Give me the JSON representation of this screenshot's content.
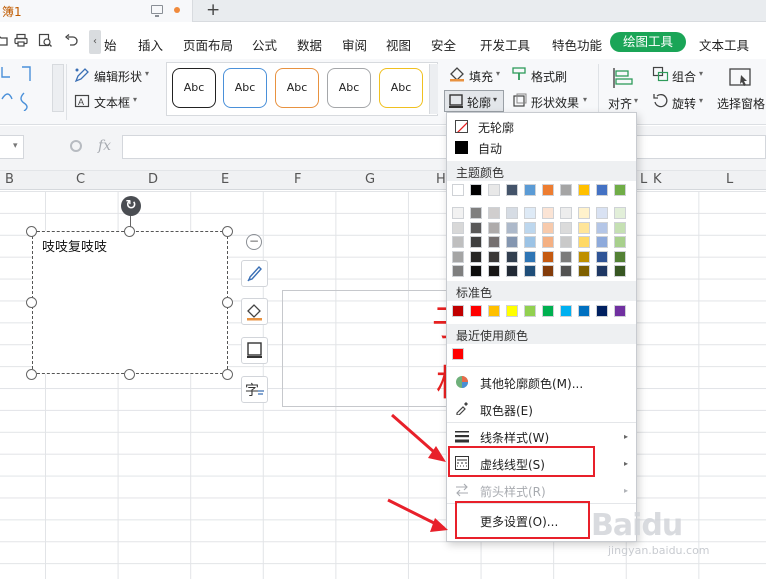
{
  "tabs": {
    "document_title": "簿1",
    "new_tab": "+"
  },
  "menu": {
    "items": [
      "始",
      "插入",
      "页面布局",
      "公式",
      "数据",
      "审阅",
      "视图",
      "安全",
      "开发工具",
      "特色功能",
      "绘图工具",
      "文本工具"
    ],
    "active": "绘图工具",
    "accent_color": "#1aa557"
  },
  "ribbon": {
    "edit_shape": "编辑形状",
    "text_box": "文本框",
    "style_samples": [
      "Abc",
      "Abc",
      "Abc",
      "Abc",
      "Abc"
    ],
    "style_borders": [
      "#222222",
      "#4a90d9",
      "#e89240",
      "#a5a7aa",
      "#f0c020"
    ],
    "fill": "填充",
    "format_painter": "格式刷",
    "outline": "轮廓",
    "shape_effects": "形状效果",
    "align": "对齐",
    "group": "组合",
    "rotate": "旋转",
    "selection_pane": "选择窗格"
  },
  "formula_bar": {
    "fx": "fx"
  },
  "columns": [
    "B",
    "C",
    "D",
    "E",
    "F",
    "G",
    "H",
    "L",
    "K",
    "L"
  ],
  "sheet": {
    "textbox_text": "吱吱复吱吱",
    "red_char_1": "子",
    "red_char_2": "相"
  },
  "outline_menu": {
    "no_outline": "无轮廓",
    "auto": "自动",
    "theme_colors_label": "主题颜色",
    "theme_top_row": [
      "#ffffff",
      "#000000",
      "#e8e8e8",
      "#44546a",
      "#5b9bd5",
      "#ed7d31",
      "#a5a5a5",
      "#ffc000",
      "#4472c4",
      "#70ad47"
    ],
    "theme_shades": [
      [
        "#f2f2f2",
        "#7f7f7f",
        "#d0cece",
        "#d6dce4",
        "#deeaf6",
        "#fbe4d5",
        "#ededed",
        "#fff2cc",
        "#d9e2f3",
        "#e2efd9"
      ],
      [
        "#d8d8d8",
        "#595959",
        "#aeabab",
        "#adb9ca",
        "#bdd7ee",
        "#f7caac",
        "#dbdbdb",
        "#ffe599",
        "#b4c6e7",
        "#c5e0b3"
      ],
      [
        "#bfbfbf",
        "#3f3f3f",
        "#757070",
        "#8496b0",
        "#9cc3e5",
        "#f4b083",
        "#c9c9c9",
        "#ffd965",
        "#8eaadb",
        "#a8d08d"
      ],
      [
        "#a5a5a5",
        "#262626",
        "#3a3838",
        "#323f4f",
        "#2e75b5",
        "#c55a11",
        "#7b7b7b",
        "#bf9000",
        "#2f5496",
        "#538135"
      ],
      [
        "#7f7f7f",
        "#0c0c0c",
        "#171616",
        "#222a35",
        "#1f4e79",
        "#833c0b",
        "#525252",
        "#7f6000",
        "#1f3864",
        "#375623"
      ]
    ],
    "standard_colors_label": "标准色",
    "standard_colors": [
      "#c00000",
      "#ff0000",
      "#ffc000",
      "#ffff00",
      "#92d050",
      "#00b050",
      "#00b0f0",
      "#0070c0",
      "#002060",
      "#7030a0"
    ],
    "recent_colors_label": "最近使用颜色",
    "recent_colors": [
      "#ff0000"
    ],
    "more_outline_colors": "其他轮廓颜色(M)...",
    "eyedropper": "取色器(E)",
    "line_style": "线条样式(W)",
    "dash_type": "虚线线型(S)",
    "arrow_style": "箭头样式(R)",
    "more_settings": "更多设置(O)..."
  },
  "watermark": {
    "brand": "Baidu",
    "sub": "jingyan.baidu.com"
  }
}
